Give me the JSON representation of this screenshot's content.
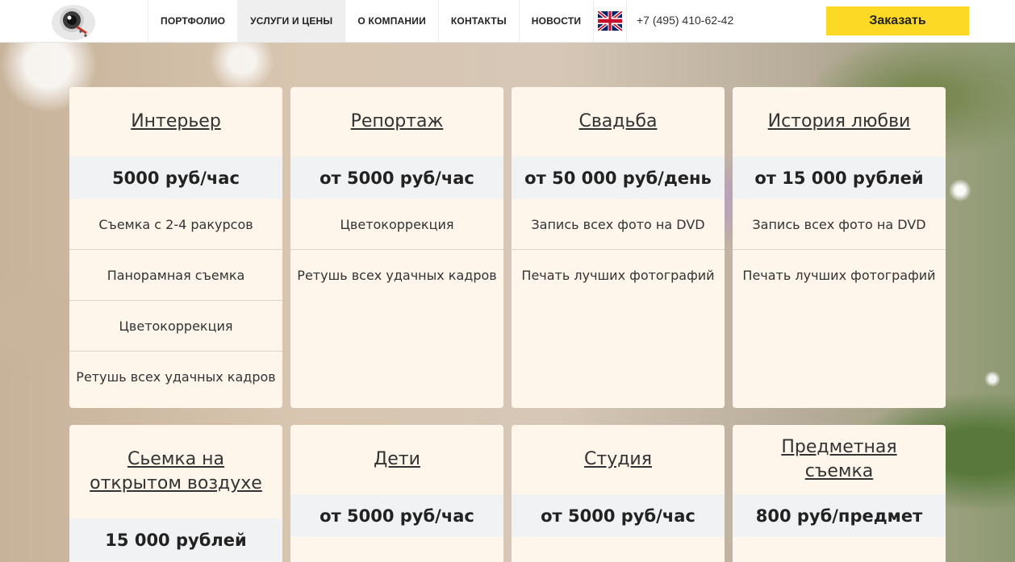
{
  "header": {
    "nav": [
      {
        "label": "ПОРТФОЛИО"
      },
      {
        "label": "УСЛУГИ И ЦЕНЫ"
      },
      {
        "label": "О КОМПАНИИ"
      },
      {
        "label": "КОНТАКТЫ"
      },
      {
        "label": "НОВОСТИ"
      }
    ],
    "active_nav": "УСЛУГИ И ЦЕНЫ",
    "language_icon": "uk-flag-icon",
    "phone": "+7 (495) 410-62-42",
    "order_label": "Заказать"
  },
  "colors": {
    "accent": "#fcd925",
    "card_bg": "#fef5eb",
    "price_bg": "#f1f2f3"
  },
  "cards": [
    {
      "title": "Интерьер",
      "price": "5000 руб/час",
      "features": [
        "Съемка с 2-4 ракурсов",
        "Панорамная съемка",
        "Цветокоррекция",
        "Ретушь всех удачных кадров"
      ]
    },
    {
      "title": "Репортаж",
      "price": "от 5000 руб/час",
      "features": [
        "Цветокоррекция",
        "Ретушь всех удачных кадров"
      ]
    },
    {
      "title": "Свадьба",
      "price": "от 50 000 руб/день",
      "features": [
        "Запись всех фото на DVD",
        "Печать лучших фотографий"
      ]
    },
    {
      "title": "История любви",
      "price": "от 15 000 рублей",
      "features": [
        "Запись всех фото на DVD",
        "Печать лучших фотографий"
      ]
    },
    {
      "title": "Сьемка на открытом воздухе",
      "price": "15 000 рублей",
      "features": []
    },
    {
      "title": "Дети",
      "price": "от 5000 руб/час",
      "features": []
    },
    {
      "title": "Студия",
      "price": "от 5000 руб/час",
      "features": []
    },
    {
      "title": "Предметная съемка",
      "price": "800 руб/предмет",
      "features": []
    }
  ]
}
